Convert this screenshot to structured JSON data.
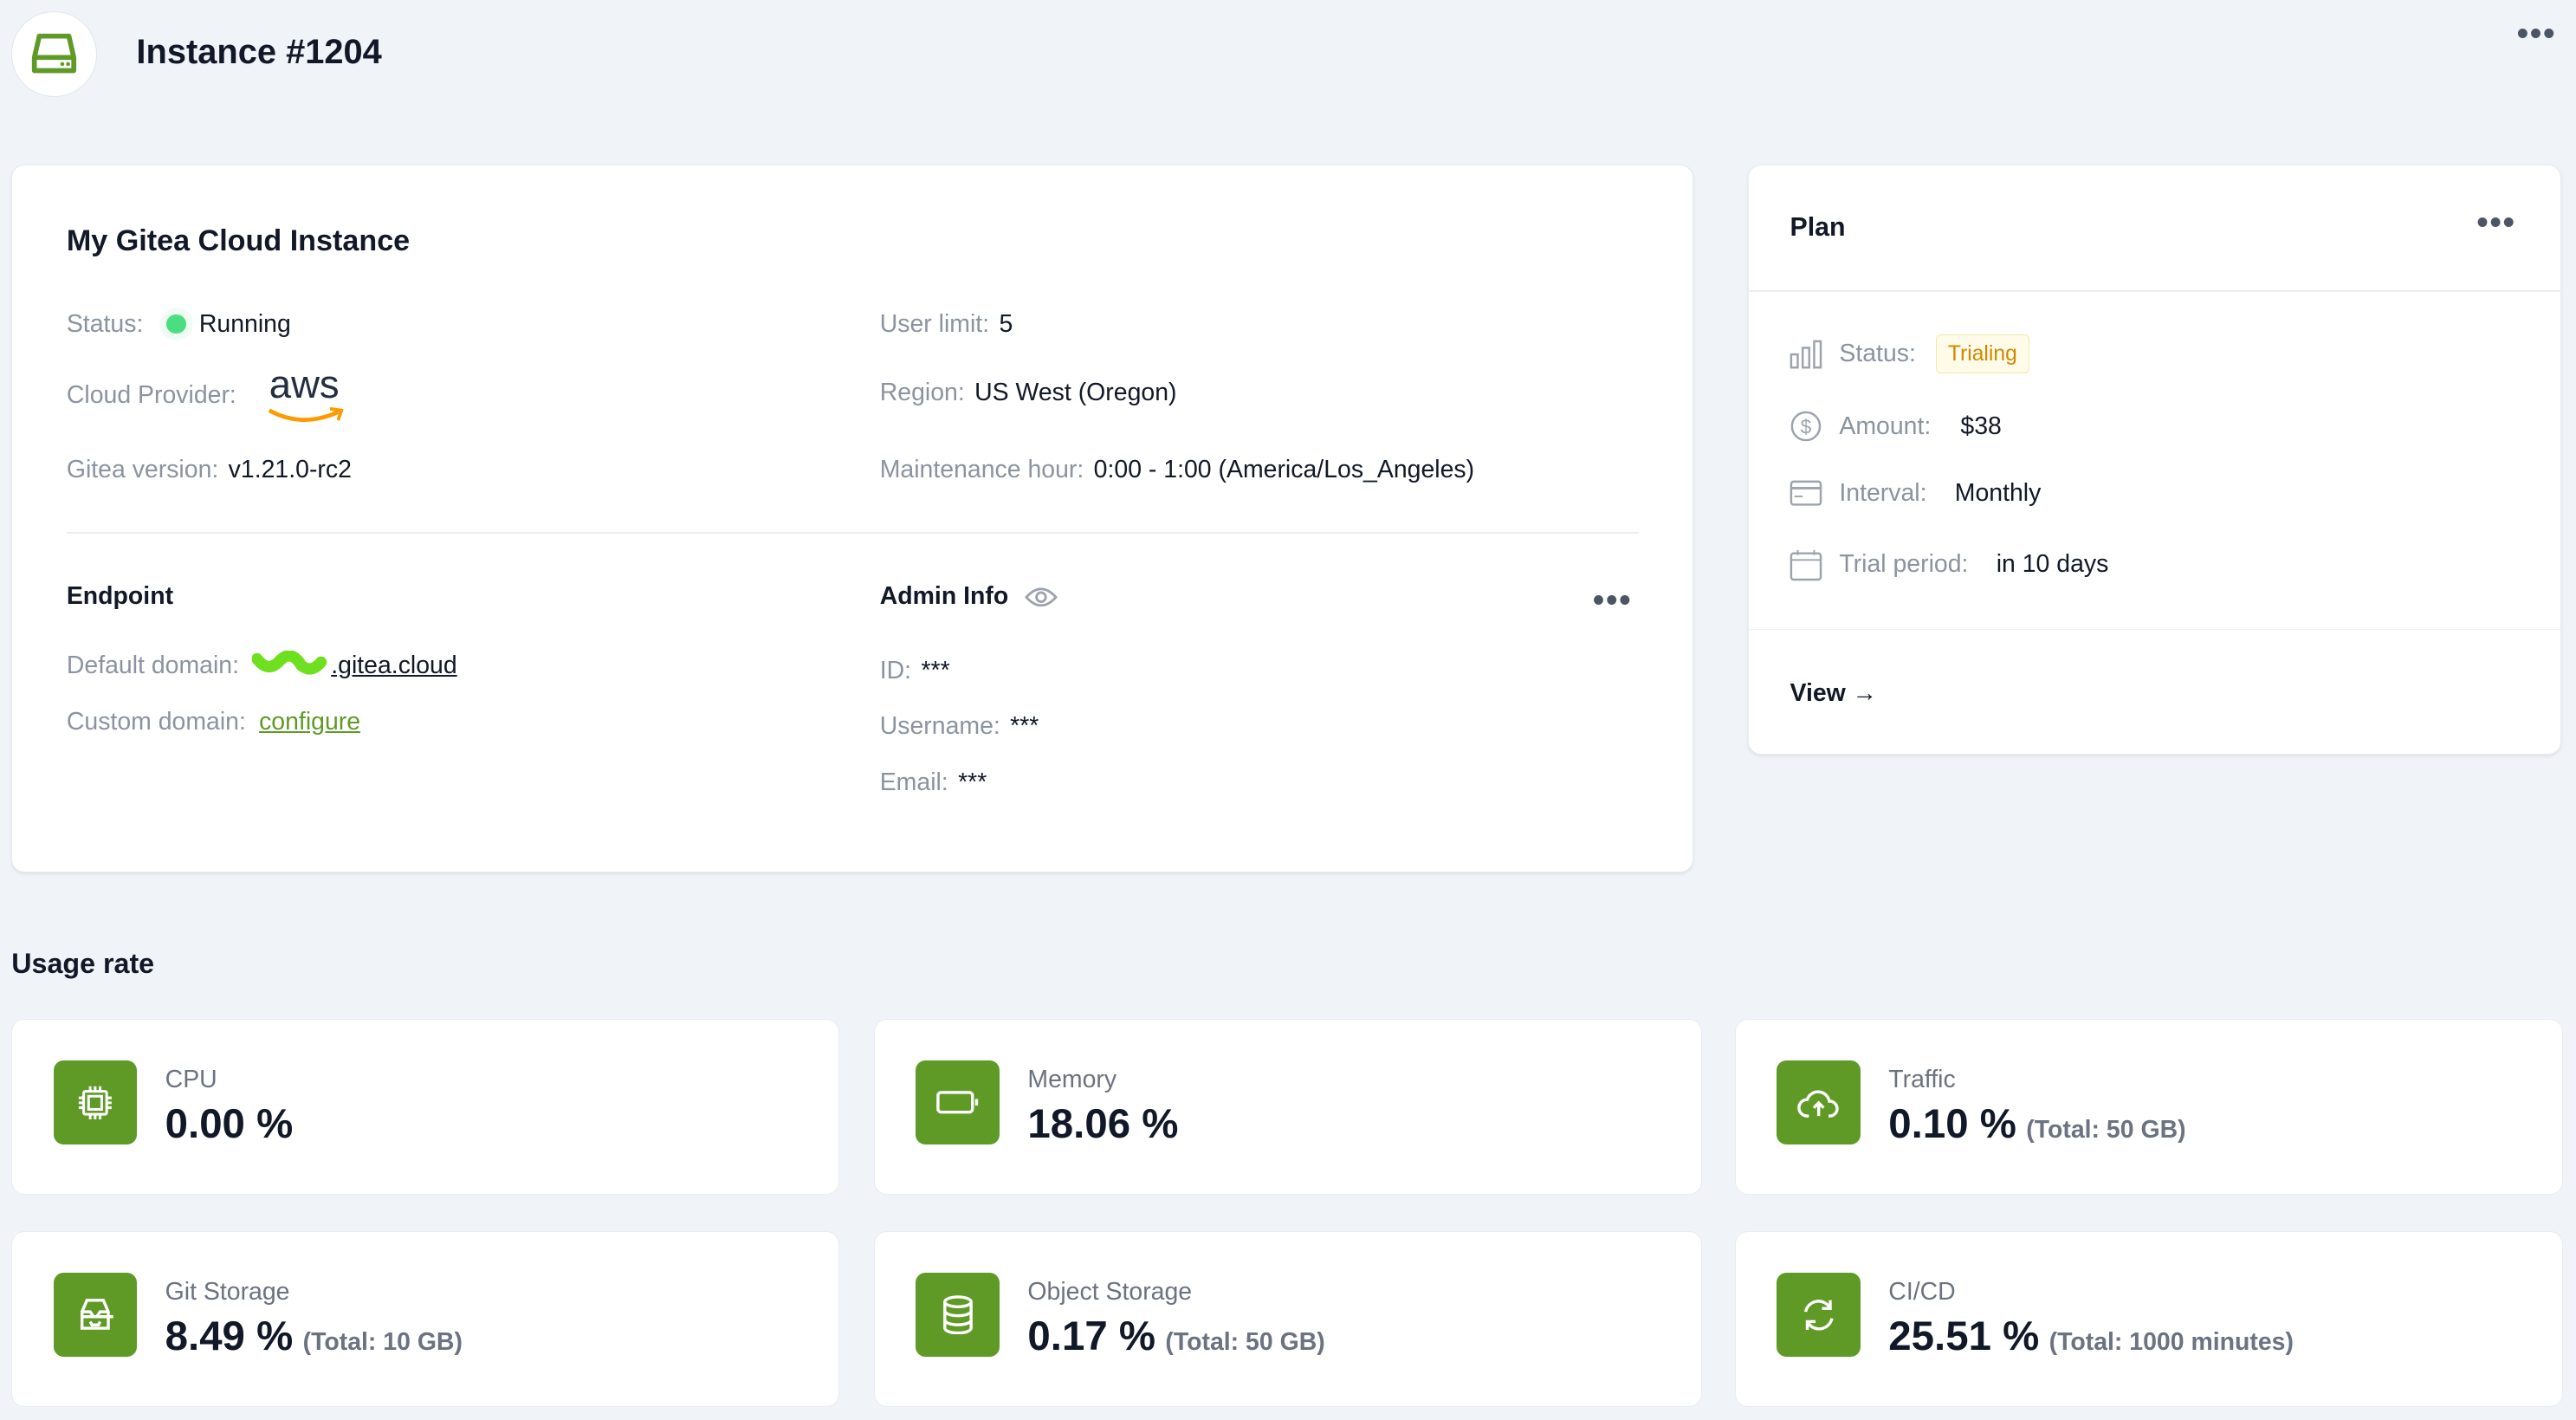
{
  "header": {
    "title": "Instance #1204"
  },
  "instance": {
    "title": "My Gitea Cloud Instance",
    "status_label": "Status:",
    "status_value": "Running",
    "provider_label": "Cloud Provider:",
    "provider_logo": "aws",
    "version_label": "Gitea version:",
    "version_value": "v1.21.0-rc2",
    "user_limit_label": "User limit:",
    "user_limit_value": "5",
    "region_label": "Region:",
    "region_value": "US West (Oregon)",
    "maint_label": "Maintenance hour:",
    "maint_value": "0:00 - 1:00 (America/Los_Angeles)",
    "endpoint_title": "Endpoint",
    "default_domain_label": "Default domain:",
    "default_domain_value": ".gitea.cloud",
    "custom_domain_label": "Custom domain:",
    "custom_domain_link": "configure",
    "admin_title": "Admin Info",
    "id_label": "ID:",
    "id_value": "***",
    "username_label": "Username:",
    "username_value": "***",
    "email_label": "Email:",
    "email_value": "***"
  },
  "plan": {
    "title": "Plan",
    "status_label": "Status:",
    "status_value": "Trialing",
    "amount_label": "Amount:",
    "amount_value": "$38",
    "interval_label": "Interval:",
    "interval_value": "Monthly",
    "trial_label": "Trial period:",
    "trial_value": "in 10 days",
    "view_label": "View →"
  },
  "usage": {
    "title": "Usage rate",
    "items": [
      {
        "name": "CPU",
        "value": "0.00 %",
        "total": ""
      },
      {
        "name": "Memory",
        "value": "18.06 %",
        "total": ""
      },
      {
        "name": "Traffic",
        "value": "0.10 %",
        "total": "(Total: 50 GB)"
      },
      {
        "name": "Git Storage",
        "value": "8.49 %",
        "total": "(Total: 10 GB)"
      },
      {
        "name": "Object Storage",
        "value": "0.17 %",
        "total": "(Total: 50 GB)"
      },
      {
        "name": "CI/CD",
        "value": "25.51 %",
        "total": "(Total: 1000 minutes)"
      }
    ]
  },
  "colors": {
    "accent": "#5f9a27",
    "running": "#4ade80",
    "trialing": "#d08700",
    "bg": "#f0f3f8"
  }
}
